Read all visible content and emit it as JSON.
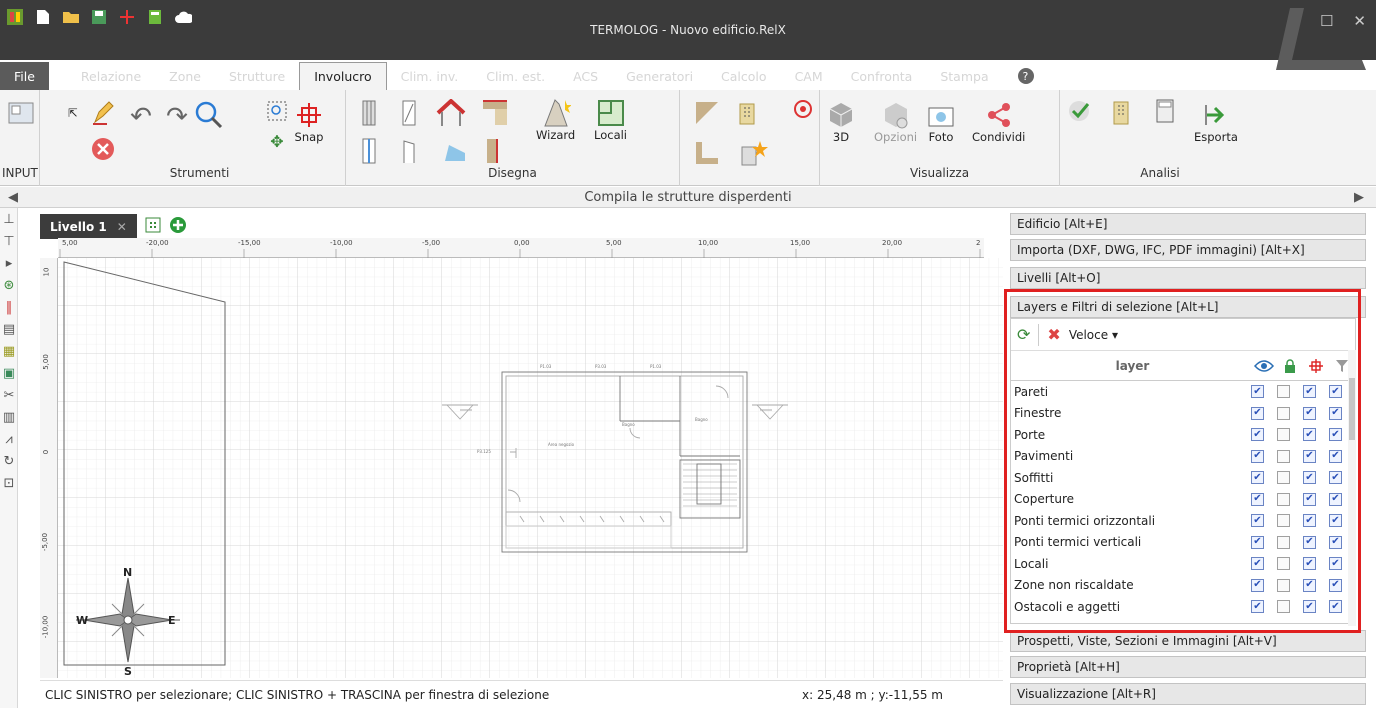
{
  "app": {
    "title": "TERMOLOG - Nuovo edificio.RelX"
  },
  "menus": [
    "File",
    "Relazione",
    "Zone",
    "Strutture",
    "Involucro",
    "Clim. inv.",
    "Clim. est.",
    "ACS",
    "Generatori",
    "Calcolo",
    "CAM",
    "Confronta",
    "Stampa"
  ],
  "ribbon": {
    "input_label": "INPUT",
    "strumenti_label": "Strumenti",
    "snap_label": "Snap",
    "wizard_label": "Wizard",
    "locali_label": "Locali",
    "disegna_label": "Disegna",
    "3d_label": "3D",
    "opzioni_label": "Opzioni",
    "foto_label": "Foto",
    "condividi_label": "Condividi",
    "visualizza_label": "Visualizza",
    "esporta_label": "Esporta",
    "analisi_label": "Analisi"
  },
  "infobar": {
    "text": "Compila le strutture disperdenti"
  },
  "canvas": {
    "tab_label": "Livello 1",
    "ruler_ticks": [
      "5,00",
      "-20,00",
      "-15,00",
      "-10,00",
      "-5,00",
      "0,00",
      "5,00",
      "10,00",
      "15,00",
      "20,00",
      "2"
    ],
    "vruler_ticks": [
      "10",
      "5,00",
      "0",
      "-5,00",
      "-10,00"
    ],
    "compass": {
      "n": "N",
      "s": "S",
      "e": "E",
      "w": "W"
    },
    "plan_labels": {
      "area": "Area negozio",
      "bagno": "Bagno",
      "p1": "P1.03",
      "p2": "P3.03",
      "p3": "P1.03",
      "p4": "P3.125",
      "p5": "Bagno"
    }
  },
  "status": {
    "hint": "CLIC SINISTRO per selezionare; CLIC SINISTRO + TRASCINA per finestra di selezione",
    "coords": "x:  25,48 m ; y:-11,55 m"
  },
  "panel": {
    "headers_top": [
      "Edificio [Alt+E]",
      "Importa (DXF, DWG, IFC, PDF immagini) [Alt+X]",
      "Livelli [Alt+O]",
      "Layers e Filtri di selezione [Alt+L]"
    ],
    "veloce_label": "Veloce",
    "layer_col": "layer",
    "layers": [
      {
        "name": "Pareti",
        "c": [
          true,
          false,
          true,
          true
        ]
      },
      {
        "name": "Finestre",
        "c": [
          true,
          false,
          true,
          true
        ]
      },
      {
        "name": "Porte",
        "c": [
          true,
          false,
          true,
          true
        ]
      },
      {
        "name": "Pavimenti",
        "c": [
          true,
          false,
          true,
          true
        ]
      },
      {
        "name": "Soffitti",
        "c": [
          true,
          false,
          true,
          true
        ]
      },
      {
        "name": "Coperture",
        "c": [
          true,
          false,
          true,
          true
        ]
      },
      {
        "name": "Ponti termici orizzontali",
        "c": [
          true,
          false,
          true,
          true
        ]
      },
      {
        "name": "Ponti termici verticali",
        "c": [
          true,
          false,
          true,
          true
        ]
      },
      {
        "name": "Locali",
        "c": [
          true,
          false,
          true,
          true
        ]
      },
      {
        "name": "Zone non riscaldate",
        "c": [
          true,
          false,
          true,
          true
        ]
      },
      {
        "name": "Ostacoli e aggetti",
        "c": [
          true,
          false,
          true,
          true
        ]
      }
    ],
    "headers_bottom": [
      "Prospetti, Viste, Sezioni e Immagini [Alt+V]",
      "Proprietà [Alt+H]",
      "Visualizzazione [Alt+R]"
    ]
  }
}
